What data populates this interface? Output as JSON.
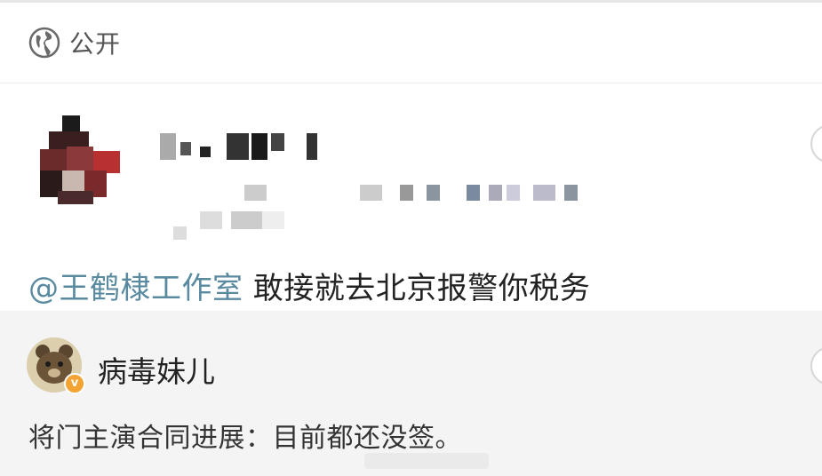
{
  "visibility": {
    "icon": "globe-icon",
    "label": "公开"
  },
  "post": {
    "mention": "@王鹤棣工作室",
    "text": " 敢接就去北京报警你税务"
  },
  "quoted": {
    "avatar_icon": "bear-avatar",
    "verified_icon": "verified-badge-icon",
    "verified_color": "#f2a332",
    "author": "病毒妹儿",
    "text": "将门主演合同进展：目前都还没签。"
  },
  "colors": {
    "mention": "#5a8aa0",
    "quote_bg": "#f4f4f4"
  }
}
